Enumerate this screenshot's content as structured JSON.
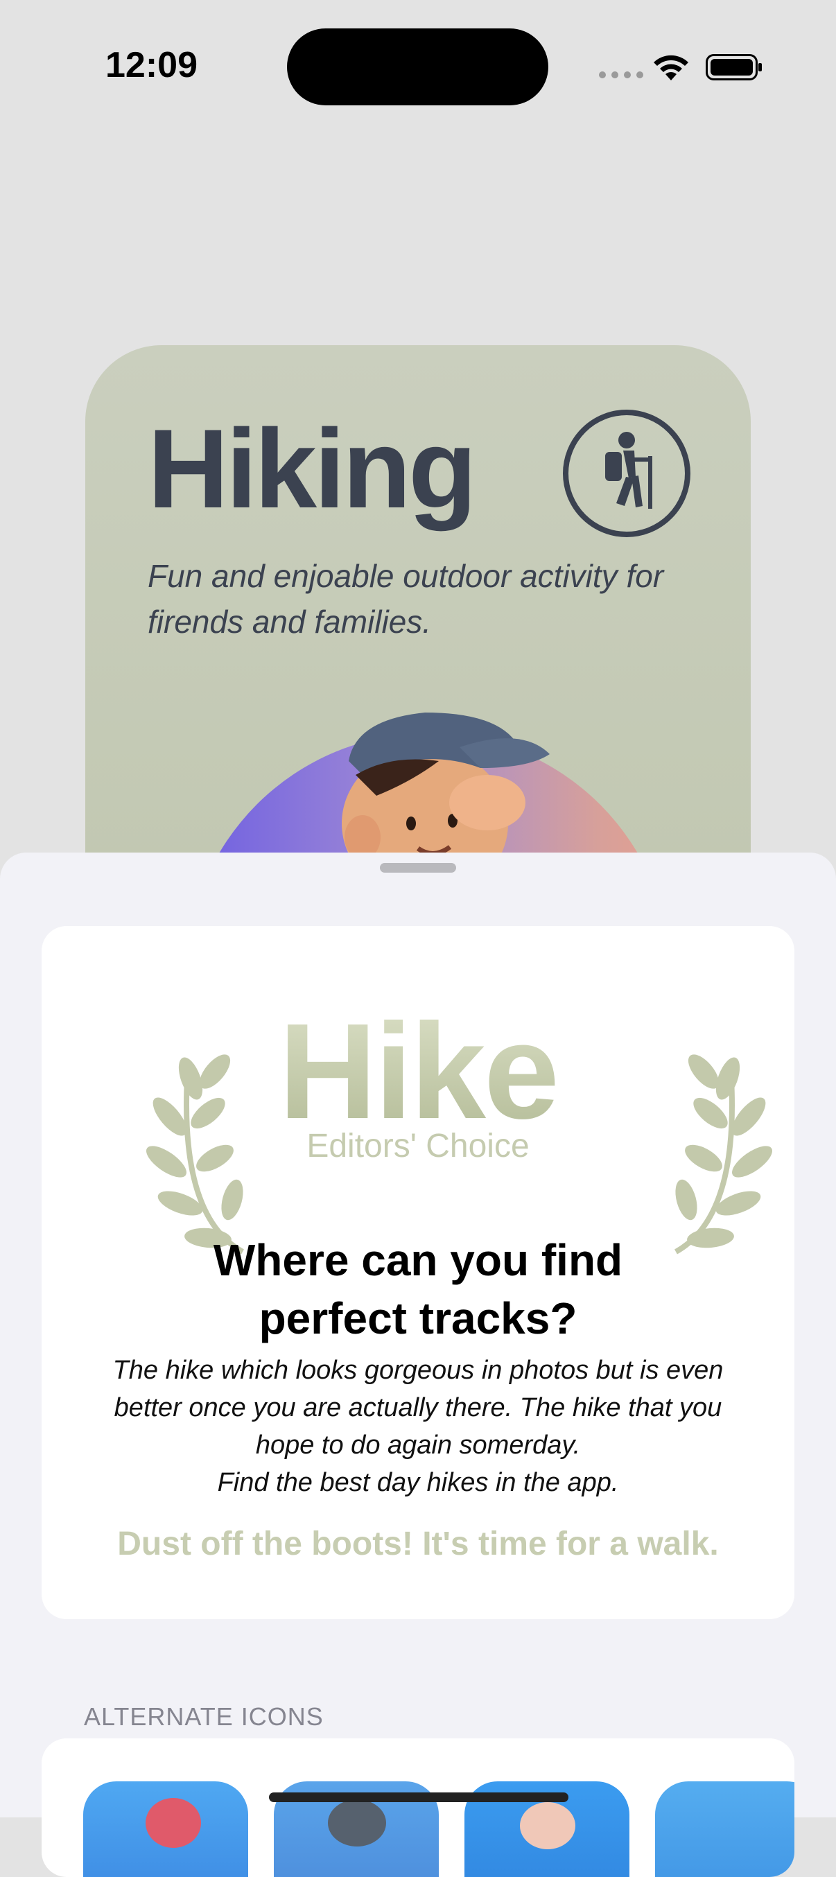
{
  "status_bar": {
    "time": "12:09"
  },
  "hike_card": {
    "title": "Hiking",
    "subtitle": "Fun and enjoable outdoor activity for firends and families.",
    "icon": "hiker-icon"
  },
  "award": {
    "word": "Hike",
    "subtitle": "Editors' Choice"
  },
  "content": {
    "headline_line1": "Where can you find",
    "headline_line2": "perfect tracks?",
    "body_line1": "The hike which looks gorgeous in photos but is even",
    "body_line2": "better once you are actually there. The hike that you",
    "body_line3": "hope to do again somerday.",
    "body_line4": "Find the best day hikes in the app.",
    "tagline": "Dust off the boots! It's time for a walk."
  },
  "alternate_icons": {
    "header": "ALTERNATE ICONS",
    "icons": [
      "app-icon-1",
      "app-icon-2",
      "app-icon-3",
      "app-icon-4"
    ]
  },
  "colors": {
    "card_bg": "#c6cbb8",
    "title_text": "#3b4250",
    "award_green": "#c4cbaa",
    "sheet_bg": "#f2f2f7"
  }
}
